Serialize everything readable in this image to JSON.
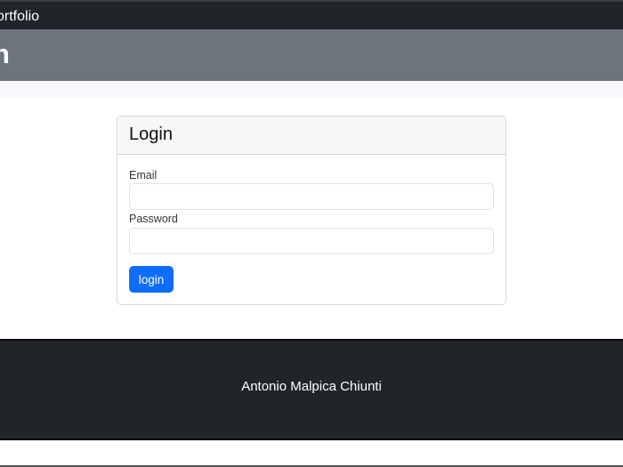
{
  "navbar": {
    "brand": "ortfolio"
  },
  "header": {
    "title": "n"
  },
  "login_card": {
    "title": "Login",
    "email_label": "Email",
    "email_value": "",
    "password_label": "Password",
    "password_value": "",
    "submit_label": "login"
  },
  "footer": {
    "text": "Antonio Malpica Chiunti"
  }
}
